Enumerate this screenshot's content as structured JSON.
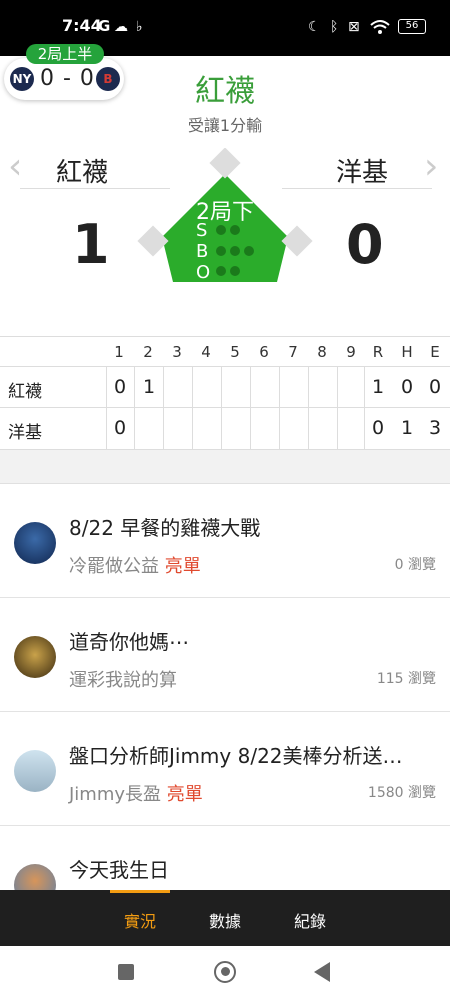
{
  "status_bar": {
    "time": "7:44",
    "carrier_icon": "G",
    "battery": "56"
  },
  "mini_score": {
    "inning_tag": "2局上半",
    "away_logo": "NY",
    "home_logo": "B",
    "score": "0 - 0"
  },
  "header": {
    "leader": "紅襪",
    "handicap": "受讓1分輸"
  },
  "teams": {
    "left_name": "紅襪",
    "right_name": "洋基",
    "left_runs": "1",
    "right_runs": "0"
  },
  "field": {
    "inning": "2局下",
    "sbo": [
      "S",
      "B",
      "O"
    ]
  },
  "boxscore": {
    "headers": [
      "1",
      "2",
      "3",
      "4",
      "5",
      "6",
      "7",
      "8",
      "9",
      "R",
      "H",
      "E"
    ],
    "rows": [
      {
        "team": "紅襪",
        "innings": [
          "0",
          "1",
          "",
          "",
          "",
          "",
          "",
          "",
          ""
        ],
        "rhe": [
          "1",
          "0",
          "0"
        ]
      },
      {
        "team": "洋基",
        "innings": [
          "0",
          "",
          "",
          "",
          "",
          "",
          "",
          "",
          ""
        ],
        "rhe": [
          "0",
          "1",
          "3"
        ]
      }
    ]
  },
  "posts": [
    {
      "title": "8/22 早餐的雞襪大戰",
      "author": "冷罷做公益",
      "tag": "亮單",
      "views": "0 瀏覽"
    },
    {
      "title": "道奇你他媽⋯",
      "author": "運彩我說的算",
      "tag": "",
      "views": "115 瀏覽"
    },
    {
      "title": "盤口分析師Jimmy 8/22美棒分析送…",
      "author": "Jimmy長盈",
      "tag": "亮單",
      "views": "1580 瀏覽"
    },
    {
      "title": "今天我生日",
      "author": "",
      "tag": "",
      "views": ""
    }
  ],
  "tabs": [
    {
      "label": "實況"
    },
    {
      "label": "數據"
    },
    {
      "label": "紀錄"
    }
  ],
  "colors": {
    "accent_green": "#25a33b",
    "tab_active": "#f39c12",
    "tag_red": "#e04a2f"
  }
}
